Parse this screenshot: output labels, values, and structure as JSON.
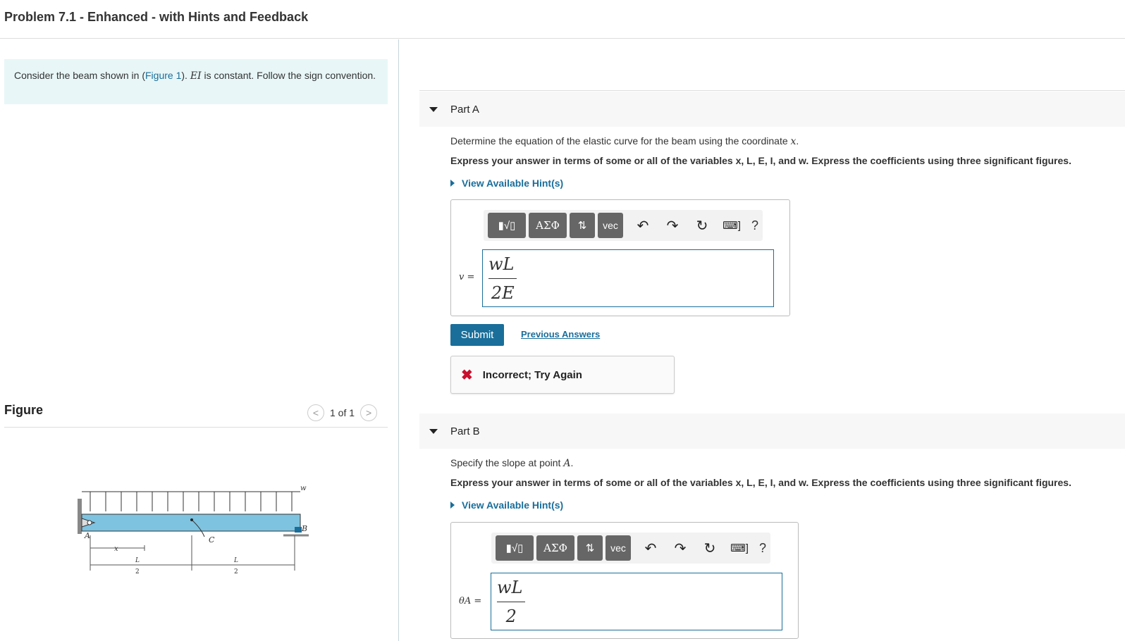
{
  "title": "Problem 7.1 - Enhanced - with Hints and Feedback",
  "intro": {
    "pre": "Consider the beam shown in (",
    "link": "Figure 1",
    "mid": "). ",
    "ei": "EI",
    "post": " is constant. Follow the sign convention."
  },
  "figure": {
    "title": "Figure",
    "counter": "1 of 1",
    "labels": {
      "w": "w",
      "A": "A",
      "B": "B",
      "C": "C",
      "x": "x",
      "L": "L",
      "two": "2"
    }
  },
  "partA": {
    "label": "Part A",
    "question": "Determine the equation of the elastic curve for the beam using the coordinate",
    "question_var": "x",
    "instruction": "Express your answer in terms of some or all of the variables x, L, E, I, and w. Express the coefficients using three significant figures.",
    "hints": "View Available Hint(s)",
    "var_label": "v =",
    "answer_num": "wL",
    "answer_den": "2E",
    "submit": "Submit",
    "previous": "Previous Answers",
    "feedback": "Incorrect; Try Again"
  },
  "partB": {
    "label": "Part B",
    "question": "Specify the slope at point",
    "question_var": "A",
    "instruction": "Express your answer in terms of some or all of the variables x, L, E, I, and w. Express the coefficients using three significant figures.",
    "hints": "View Available Hint(s)",
    "var_label": "θA =",
    "answer_num": "wL",
    "answer_den": "2"
  },
  "toolbar": {
    "templates": "▮√▯",
    "greek": "ΑΣΦ",
    "arrows": "⇅",
    "vec": "vec",
    "undo": "↶",
    "redo": "↷",
    "reset": "↻",
    "keyboard": "⌨]",
    "help": "?"
  }
}
